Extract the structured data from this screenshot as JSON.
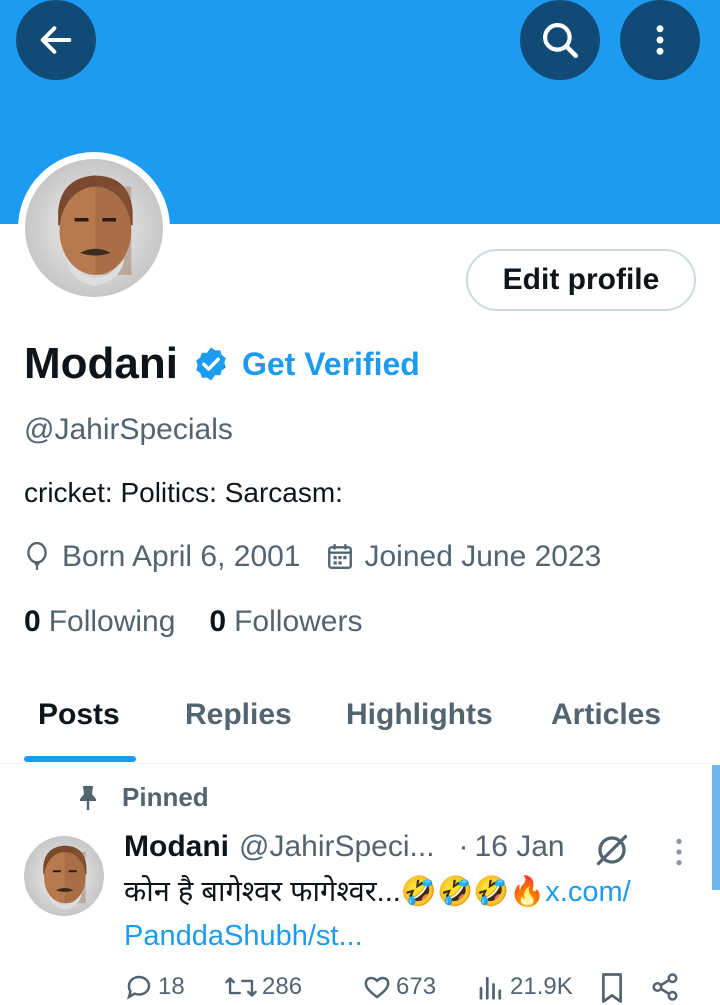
{
  "header": {
    "back_icon": "arrow-left-icon",
    "search_icon": "search-icon",
    "more_icon": "more-vertical-icon",
    "banner_color": "#1d9bf0"
  },
  "profile": {
    "edit_label": "Edit profile",
    "name": "Modani",
    "get_verified": "Get Verified",
    "handle": "@JahirSpecials",
    "bio": "cricket: Politics: Sarcasm:",
    "born": "Born April 6, 2001",
    "joined": "Joined June 2023",
    "following_count": "0",
    "following_label": "Following",
    "followers_count": "0",
    "followers_label": "Followers"
  },
  "tabs": [
    {
      "label": "Posts",
      "active": true
    },
    {
      "label": "Replies",
      "active": false
    },
    {
      "label": "Highlights",
      "active": false
    },
    {
      "label": "Articles",
      "active": false
    }
  ],
  "post": {
    "pinned_label": "Pinned",
    "author": "Modani",
    "handle": "@JahirSpeci...",
    "dot": "·",
    "date": "16 Jan",
    "text": "कोन है बागेश्वर फागेश्वर...🤣🤣🤣🔥",
    "link_part1": "x.com/",
    "link_part2": "PanddaShubh/st...",
    "replies": "18",
    "reposts": "286",
    "likes": "673",
    "views": "21.9K"
  },
  "colors": {
    "accent": "#1d9bf0",
    "text_primary": "#0f1419",
    "text_secondary": "#536471"
  }
}
